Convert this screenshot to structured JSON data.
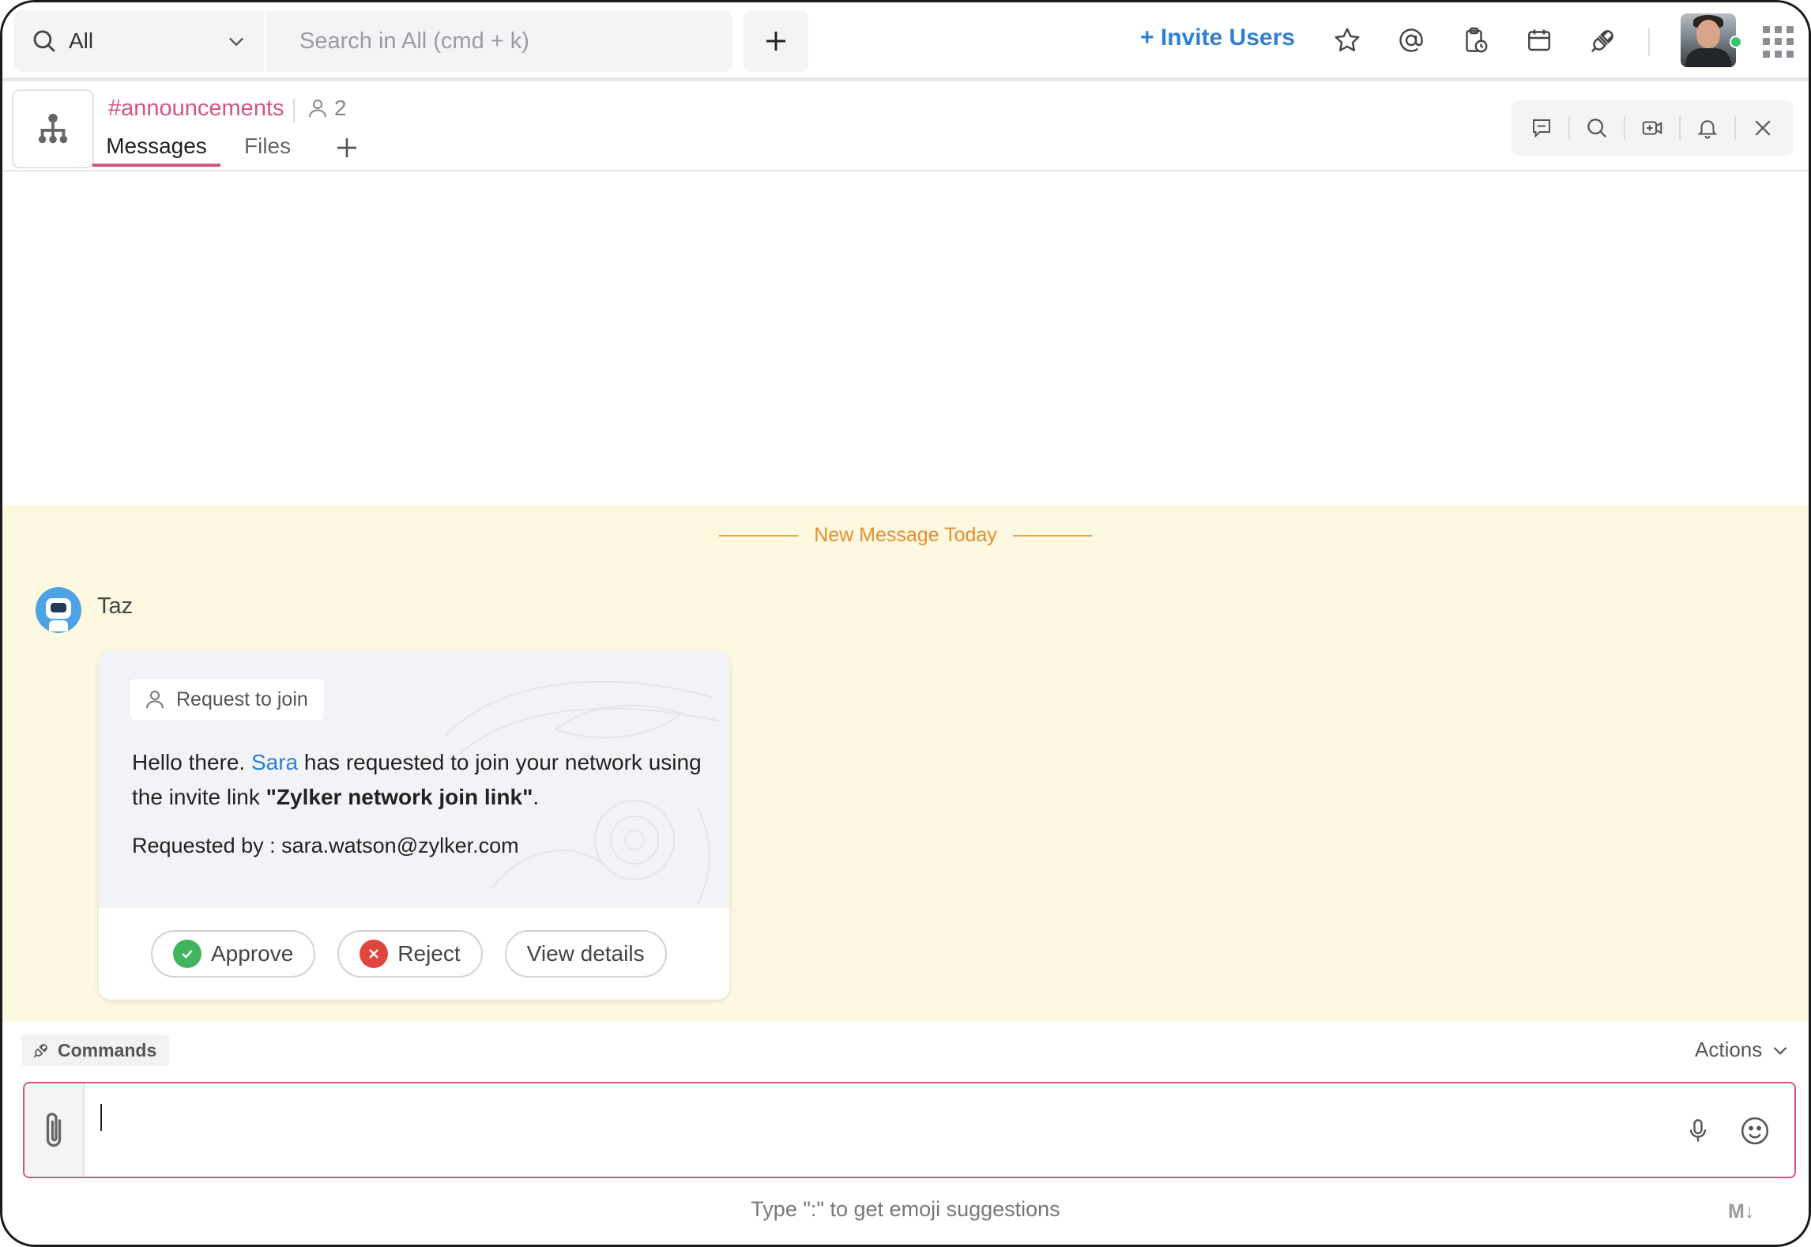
{
  "top_bar": {
    "search_scope": "All",
    "search_placeholder": "Search in All (cmd + k)",
    "invite_label": "+ Invite Users",
    "icons": [
      "star-icon",
      "mention-icon",
      "clipboard-clock-icon",
      "calendar-icon",
      "plug-icon",
      "apps-grid-icon"
    ],
    "presence_color": "#3cc26b"
  },
  "channel": {
    "name": "#announcements",
    "member_count": "2",
    "tabs": [
      {
        "label": "Messages",
        "active": true
      },
      {
        "label": "Files",
        "active": false
      }
    ],
    "accent": "#d5557f",
    "tools": [
      "thread-icon",
      "search-icon",
      "video-add-icon",
      "bell-icon",
      "close-icon"
    ]
  },
  "messages": {
    "new_divider": "New Message Today",
    "sender": "Taz",
    "card": {
      "tag": "Request to join",
      "text_before": "Hello there. ",
      "name": "Sara",
      "text_middle": " has requested to join your network using the invite link ",
      "link_name": "\"Zylker network join link\"",
      "text_after": ".",
      "requested_by": "Requested by : sara.watson@zylker.com",
      "buttons": {
        "approve": "Approve",
        "reject": "Reject",
        "view": "View details"
      }
    }
  },
  "composer": {
    "commands_label": "Commands",
    "actions_label": "Actions",
    "hint": "Type \":\" to get emoji suggestions",
    "markdown_badge": "M↓"
  }
}
